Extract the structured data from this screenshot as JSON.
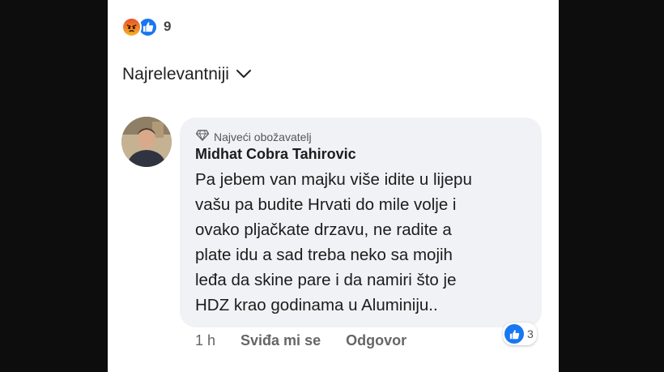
{
  "reactions": {
    "icons": [
      "angry-icon",
      "like-icon"
    ],
    "count": "9"
  },
  "sort": {
    "label": "Najrelevantniji",
    "icon": "chevron-down-icon"
  },
  "comment": {
    "badge": "Najveći obožavatelj",
    "author": "Midhat Cobra Tahirovic",
    "lines": [
      "Pa jebem van majku više idite u lijepu",
      "vašu pa budite Hrvati do mile volje i",
      "ovako pljačkate drzavu, ne radite a",
      "plate idu a sad treba neko sa mojih",
      "leđa da skine pare i da namiri što je",
      "HDZ krao godinama u Aluminiju.."
    ],
    "likes": "3",
    "time": "1 h",
    "like_label": "Sviđa mi se",
    "reply_label": "Odgovor"
  },
  "colors": {
    "like_blue": "#1877f2",
    "bubble_bg": "#f0f2f5",
    "background": "#0d0d0d"
  }
}
